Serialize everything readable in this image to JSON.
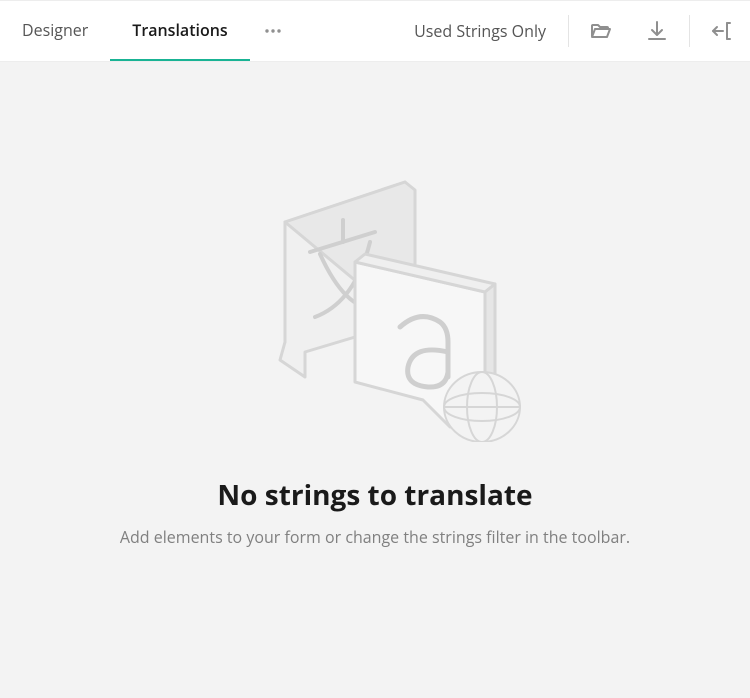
{
  "tabs": [
    {
      "label": "Designer",
      "active": false
    },
    {
      "label": "Translations",
      "active": true
    }
  ],
  "toolbar": {
    "used_strings_label": "Used Strings Only",
    "icons": {
      "more": "more-options-icon",
      "open": "folder-open-icon",
      "download": "download-icon",
      "import": "import-icon"
    }
  },
  "empty_state": {
    "title": "No strings to translate",
    "subtitle": "Add elements to your form or change the strings filter in the toolbar."
  },
  "colors": {
    "accent": "#19b394",
    "muted_line": "#d6d6d6"
  }
}
